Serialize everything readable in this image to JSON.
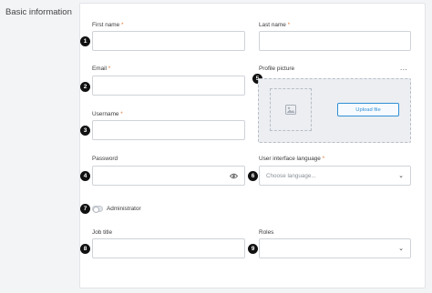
{
  "section": {
    "title": "Basic information"
  },
  "badges": [
    "1",
    "2",
    "3",
    "4",
    "5",
    "6",
    "7",
    "8",
    "9"
  ],
  "fields": {
    "first_name": {
      "label": "First name",
      "required": "*",
      "value": ""
    },
    "last_name": {
      "label": "Last name",
      "required": "*",
      "value": ""
    },
    "email": {
      "label": "Email",
      "required": "*",
      "value": ""
    },
    "profile_picture": {
      "label": "Profile picture",
      "more": "...",
      "upload_label": "Upload file",
      "placeholder_icon": "image-icon"
    },
    "username": {
      "label": "Username",
      "required": "*",
      "value": ""
    },
    "password": {
      "label": "Password",
      "value": "",
      "icon": "eye-icon"
    },
    "ui_language": {
      "label": "User interface language",
      "required": "*",
      "placeholder": "Choose language..."
    },
    "administrator": {
      "label": "Administrator",
      "enabled": false
    },
    "job_title": {
      "label": "Job title",
      "value": ""
    },
    "roles": {
      "label": "Roles",
      "value": ""
    }
  },
  "colors": {
    "accent": "#2f8fd6",
    "required": "#e07b39",
    "badge": "#111111"
  }
}
